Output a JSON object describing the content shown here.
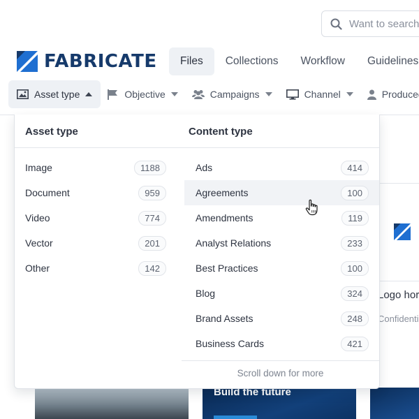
{
  "search": {
    "placeholder": "Want to search"
  },
  "brand": {
    "name": "FABRICATE",
    "color": "#163a6b",
    "accent": "#1f6fd1"
  },
  "nav": {
    "tabs": [
      {
        "label": "Files",
        "active": true
      },
      {
        "label": "Collections",
        "active": false
      },
      {
        "label": "Workflow",
        "active": false
      },
      {
        "label": "Guidelines",
        "active": false
      }
    ]
  },
  "filters": [
    {
      "label": "Asset type",
      "icon": "image-icon",
      "active": true
    },
    {
      "label": "Objective",
      "icon": "flag-icon",
      "active": false
    },
    {
      "label": "Campaigns",
      "icon": "users-icon",
      "active": false
    },
    {
      "label": "Channel",
      "icon": "monitor-icon",
      "active": false
    },
    {
      "label": "Produced b",
      "icon": "user-icon",
      "active": false
    }
  ],
  "dropdown": {
    "asset_type": {
      "heading": "Asset type",
      "items": [
        {
          "label": "Image",
          "count": "1188"
        },
        {
          "label": "Document",
          "count": "959"
        },
        {
          "label": "Video",
          "count": "774"
        },
        {
          "label": "Vector",
          "count": "201"
        },
        {
          "label": "Other",
          "count": "142"
        }
      ]
    },
    "content_type": {
      "heading": "Content type",
      "items": [
        {
          "label": "Ads",
          "count": "414"
        },
        {
          "label": "Agreements",
          "count": "100"
        },
        {
          "label": "Amendments",
          "count": "119"
        },
        {
          "label": "Analyst Relations",
          "count": "233"
        },
        {
          "label": "Best Practices",
          "count": "100"
        },
        {
          "label": "Blog",
          "count": "324"
        },
        {
          "label": "Brand Assets",
          "count": "248"
        },
        {
          "label": "Business Cards",
          "count": "421"
        }
      ]
    },
    "more_label": "Scroll down for more"
  },
  "background": {
    "card_title": "Logo hor",
    "card_subtitle": "Confidenti",
    "thumb_text": "Build the future"
  }
}
